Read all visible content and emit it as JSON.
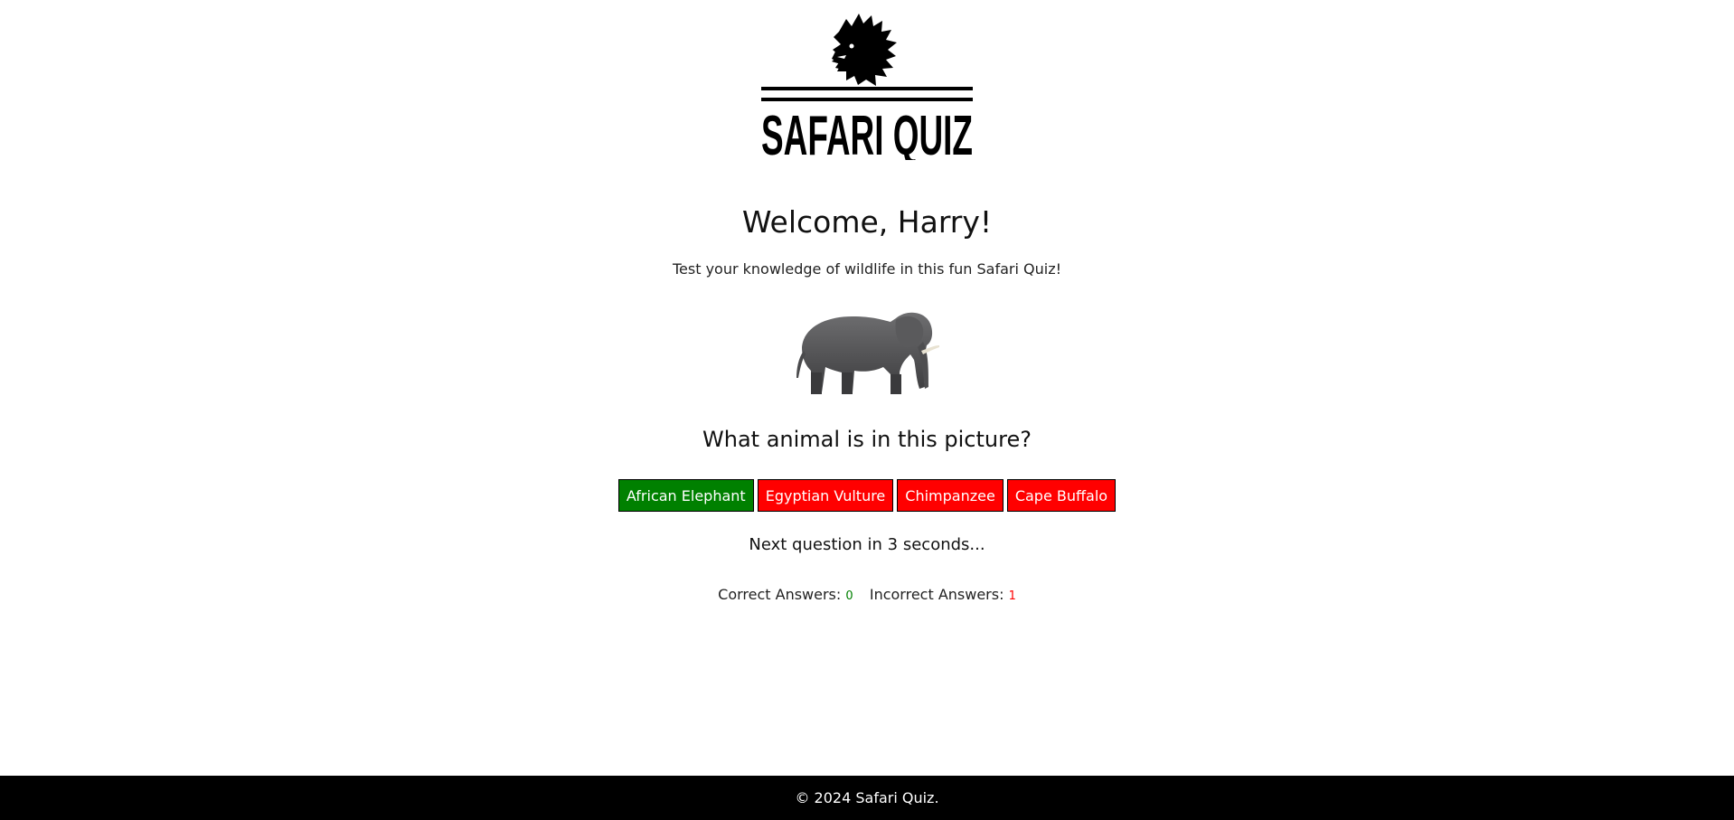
{
  "logo": {
    "text": "SAFARI QUIZ",
    "icon": "lion-head-icon"
  },
  "welcome": {
    "text": "Welcome, Harry!"
  },
  "subtitle": {
    "text": "Test your knowledge of wildlife in this fun Safari Quiz!"
  },
  "animal": {
    "icon": "elephant-image"
  },
  "question": {
    "text": "What animal is in this picture?"
  },
  "answers": [
    {
      "label": "African Elephant",
      "state": "correct"
    },
    {
      "label": "Egyptian Vulture",
      "state": "wrong"
    },
    {
      "label": "Chimpanzee",
      "state": "wrong"
    },
    {
      "label": "Cape Buffalo",
      "state": "wrong"
    }
  ],
  "next": {
    "text": "Next question in 3 seconds..."
  },
  "score": {
    "correct_label": "Correct Answers:",
    "correct_value": "0",
    "incorrect_label": "Incorrect Answers:",
    "incorrect_value": "1"
  },
  "footer": {
    "text": "© 2024 Safari Quiz."
  },
  "colors": {
    "correct": "#008000",
    "wrong": "#ff0000",
    "footer_bg": "#000000"
  }
}
